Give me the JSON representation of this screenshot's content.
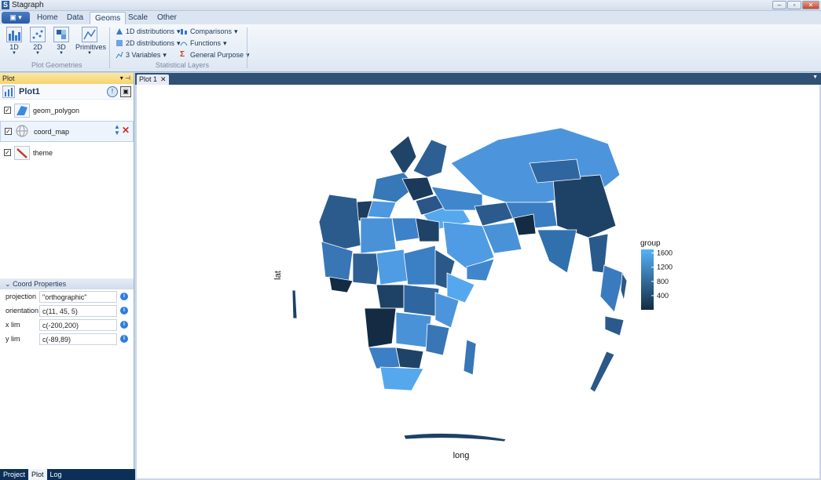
{
  "window": {
    "title": "Stagraph"
  },
  "app_menu_icon": "app-menu-icon",
  "ribbon_tabs": [
    "Home",
    "Data",
    "Geoms",
    "Scale",
    "Other"
  ],
  "ribbon": {
    "plot_geometries": {
      "label": "Plot Geometries",
      "buttons": [
        "1D",
        "2D",
        "3D",
        "Primitives"
      ]
    },
    "statistical_layers": {
      "label": "Statistical Layers",
      "buttons": [
        "1D distributions",
        "2D distributions",
        "3 Variables",
        "Comparisons",
        "Functions",
        "General Purpose"
      ]
    }
  },
  "plot_panel": {
    "header": "Plot",
    "plot_name": "Plot1",
    "layers": [
      {
        "label": "geom_polygon",
        "checked": true
      },
      {
        "label": "coord_map",
        "checked": true
      },
      {
        "label": "theme",
        "checked": true
      }
    ]
  },
  "coord_properties": {
    "header": "Coord Properties",
    "rows": [
      {
        "name": "projection",
        "value": "\"orthographic\""
      },
      {
        "name": "orientation",
        "value": "c(11, 45, 5)"
      },
      {
        "name": "x lim",
        "value": "c(-200,200)"
      },
      {
        "name": "y lim",
        "value": "c(-89,89)"
      }
    ]
  },
  "bottom_tabs": [
    "Project",
    "Plot",
    "Log"
  ],
  "active_bottom_tab": "Plot",
  "document_tab": "Plot 1",
  "colors": {
    "low": "#132b43",
    "high": "#56b1f7",
    "ribbon": "#dde7f3",
    "panel_header": "#f6d46e"
  },
  "chart_data": {
    "type": "map",
    "projection": "orthographic",
    "xlabel": "long",
    "ylabel": "lat",
    "legend": {
      "title": "group",
      "ticks": [
        400,
        800,
        1200,
        1600
      ],
      "range": [
        1,
        1700
      ],
      "placement": "right"
    }
  }
}
